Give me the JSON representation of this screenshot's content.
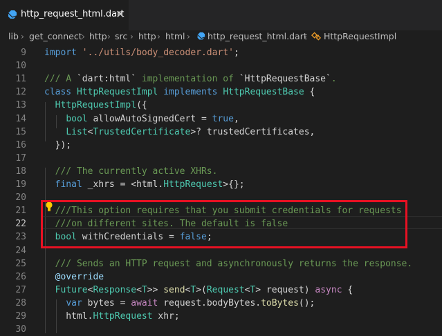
{
  "tab": {
    "title": "http_request_html.dart",
    "close_glyph": "✕",
    "icon": "dart-file-icon"
  },
  "breadcrumb": {
    "items": [
      "lib",
      "get_connect",
      "http",
      "src",
      "http",
      "html",
      "http_request_html.dart",
      "HttpRequestImpl"
    ],
    "separator": "›"
  },
  "editor": {
    "active_line": "22",
    "lines": [
      {
        "n": "9",
        "segs": [
          [
            "kw",
            "import"
          ],
          [
            "id",
            " "
          ],
          [
            "str",
            "'../utils/body_decoder.dart'"
          ],
          [
            "id",
            ";"
          ]
        ]
      },
      {
        "n": "10",
        "segs": []
      },
      {
        "n": "11",
        "segs": [
          [
            "cm",
            "/// A "
          ],
          [
            "id",
            "`dart:html`"
          ],
          [
            "cm",
            " implementation of "
          ],
          [
            "id",
            "`HttpRequestBase`"
          ],
          [
            "cm",
            "."
          ]
        ]
      },
      {
        "n": "12",
        "segs": [
          [
            "kw",
            "class"
          ],
          [
            "id",
            " "
          ],
          [
            "ty",
            "HttpRequestImpl"
          ],
          [
            "id",
            " "
          ],
          [
            "kw",
            "implements"
          ],
          [
            "id",
            " "
          ],
          [
            "ty",
            "HttpRequestBase"
          ],
          [
            "id",
            " {"
          ]
        ]
      },
      {
        "n": "13",
        "segs": [
          [
            "id",
            "  "
          ],
          [
            "ty",
            "HttpRequestImpl"
          ],
          [
            "id",
            "({"
          ]
        ]
      },
      {
        "n": "14",
        "segs": [
          [
            "id",
            "    "
          ],
          [
            "ty",
            "bool"
          ],
          [
            "id",
            " allowAutoSignedCert = "
          ],
          [
            "kw",
            "true"
          ],
          [
            "id",
            ","
          ]
        ]
      },
      {
        "n": "15",
        "segs": [
          [
            "id",
            "    "
          ],
          [
            "ty",
            "List"
          ],
          [
            "id",
            "<"
          ],
          [
            "ty",
            "TrustedCertificate"
          ],
          [
            "id",
            ">? trustedCertificates,"
          ]
        ]
      },
      {
        "n": "16",
        "segs": [
          [
            "id",
            "  });"
          ]
        ]
      },
      {
        "n": "17",
        "segs": []
      },
      {
        "n": "18",
        "segs": [
          [
            "cm",
            "  /// The currently active XHRs."
          ]
        ]
      },
      {
        "n": "19",
        "segs": [
          [
            "id",
            "  "
          ],
          [
            "kw",
            "final"
          ],
          [
            "id",
            " _xhrs = <html."
          ],
          [
            "ty",
            "HttpRequest"
          ],
          [
            "id",
            ">{};"
          ]
        ]
      },
      {
        "n": "20",
        "segs": []
      },
      {
        "n": "21",
        "segs": [
          [
            "cm",
            "  ///This option requires that you submit credentials for requests"
          ]
        ]
      },
      {
        "n": "22",
        "segs": [
          [
            "cm",
            "  ///on different sites. The default is false"
          ]
        ]
      },
      {
        "n": "23",
        "segs": [
          [
            "id",
            "  "
          ],
          [
            "ty",
            "bool"
          ],
          [
            "id",
            " withCredentials = "
          ],
          [
            "kw",
            "false"
          ],
          [
            "id",
            ";"
          ]
        ]
      },
      {
        "n": "24",
        "segs": []
      },
      {
        "n": "25",
        "segs": [
          [
            "cm",
            "  /// Sends an HTTP request and asynchronously returns the response."
          ]
        ]
      },
      {
        "n": "26",
        "segs": [
          [
            "id",
            "  "
          ],
          [
            "vr",
            "@override"
          ]
        ]
      },
      {
        "n": "27",
        "segs": [
          [
            "id",
            "  "
          ],
          [
            "ty",
            "Future"
          ],
          [
            "id",
            "<"
          ],
          [
            "ty",
            "Response"
          ],
          [
            "id",
            "<"
          ],
          [
            "ty",
            "T"
          ],
          [
            "id",
            ">> "
          ],
          [
            "fn",
            "send"
          ],
          [
            "id",
            "<"
          ],
          [
            "ty",
            "T"
          ],
          [
            "id",
            ">("
          ],
          [
            "ty",
            "Request"
          ],
          [
            "id",
            "<"
          ],
          [
            "ty",
            "T"
          ],
          [
            "id",
            "> request) "
          ],
          [
            "kw2",
            "async"
          ],
          [
            "id",
            " {"
          ]
        ]
      },
      {
        "n": "28",
        "segs": [
          [
            "id",
            "    "
          ],
          [
            "kw",
            "var"
          ],
          [
            "id",
            " bytes = "
          ],
          [
            "kw2",
            "await"
          ],
          [
            "id",
            " request.bodyBytes."
          ],
          [
            "fn",
            "toBytes"
          ],
          [
            "id",
            "();"
          ]
        ]
      },
      {
        "n": "29",
        "segs": [
          [
            "id",
            "    html."
          ],
          [
            "ty",
            "HttpRequest"
          ],
          [
            "id",
            " xhr;"
          ]
        ]
      },
      {
        "n": "30",
        "segs": []
      }
    ]
  }
}
